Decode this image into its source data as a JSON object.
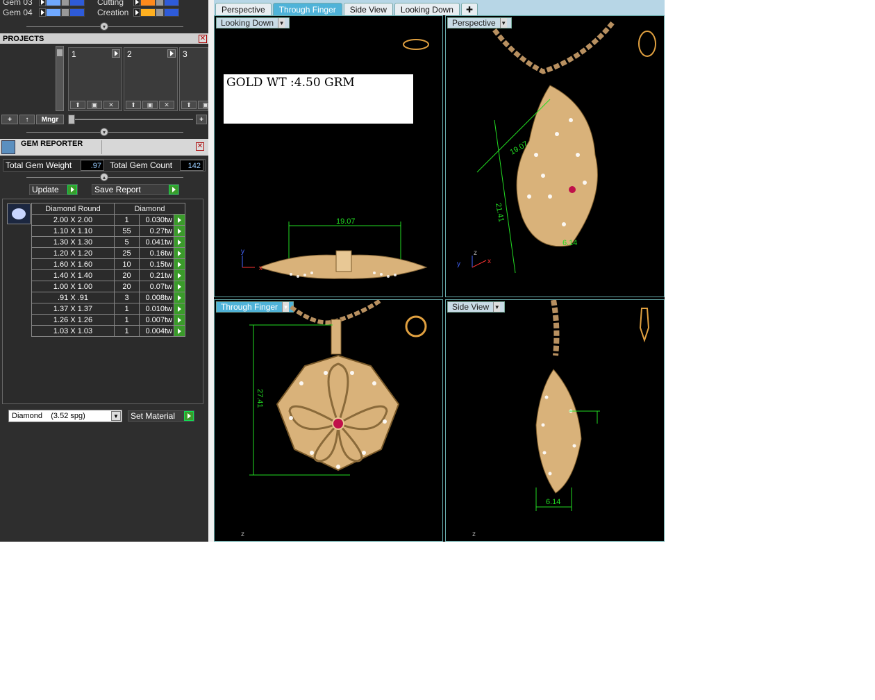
{
  "gems_list": [
    {
      "label": "Gem 03"
    },
    {
      "label": "Gem 04"
    }
  ],
  "layers": [
    {
      "label": "Cutting"
    },
    {
      "label": "Creation"
    }
  ],
  "projects": {
    "title": "PROJECTS",
    "slots": [
      {
        "num": "1"
      },
      {
        "num": "2"
      },
      {
        "num": "3"
      }
    ],
    "mngr_label": "Mngr"
  },
  "gem_reporter": {
    "title": "GEM REPORTER",
    "total_weight_label": "Total Gem Weight",
    "total_weight_value": ".97",
    "total_count_label": "Total Gem Count",
    "total_count_value": "142",
    "update_label": "Update",
    "save_report_label": "Save Report",
    "columns": [
      "Diamond Round",
      "Diamond"
    ],
    "rows": [
      {
        "size": "2.00 X 2.00",
        "count": "1",
        "weight": "0.030tw"
      },
      {
        "size": "1.10 X 1.10",
        "count": "55",
        "weight": "0.27tw"
      },
      {
        "size": "1.30 X 1.30",
        "count": "5",
        "weight": "0.041tw"
      },
      {
        "size": "1.20 X 1.20",
        "count": "25",
        "weight": "0.16tw"
      },
      {
        "size": "1.60 X 1.60",
        "count": "10",
        "weight": "0.15tw"
      },
      {
        "size": "1.40 X 1.40",
        "count": "20",
        "weight": "0.21tw"
      },
      {
        "size": "1.00 X 1.00",
        "count": "20",
        "weight": "0.07tw"
      },
      {
        "size": ".91 X .91",
        "count": "3",
        "weight": "0.008tw"
      },
      {
        "size": "1.37 X 1.37",
        "count": "1",
        "weight": "0.010tw"
      },
      {
        "size": "1.26 X 1.26",
        "count": "1",
        "weight": "0.007tw"
      },
      {
        "size": "1.03 X 1.03",
        "count": "1",
        "weight": "0.004tw"
      }
    ],
    "material_select": "Diamond    (3.52 spg)",
    "set_material_label": "Set Material"
  },
  "viewport_tabs": [
    {
      "label": "Perspective",
      "active": false
    },
    {
      "label": "Through Finger",
      "active": true
    },
    {
      "label": "Side View",
      "active": false
    },
    {
      "label": "Looking Down",
      "active": false
    }
  ],
  "viewports": {
    "top_left": {
      "label": "Looking Down",
      "note": "GOLD WT :4.50 GRM",
      "dimension": "19.07",
      "axis_y": "y",
      "axis_x": "x"
    },
    "top_right": {
      "label": "Perspective",
      "dim_a": "19.07",
      "dim_b": "21.41",
      "dim_c": "6.14",
      "axis_z": "z",
      "axis_y": "y",
      "axis_x": "x"
    },
    "bottom_left": {
      "label": "Through Finger",
      "dimension": "27.41",
      "axis_z": "z"
    },
    "bottom_right": {
      "label": "Side View",
      "dimension": "6.14",
      "axis_z": "z"
    }
  },
  "colors": {
    "gold": "#d9b27a",
    "dimension_line": "#22dd22",
    "active_tab": "#4fb3d9",
    "ruby": "#c0104a"
  }
}
